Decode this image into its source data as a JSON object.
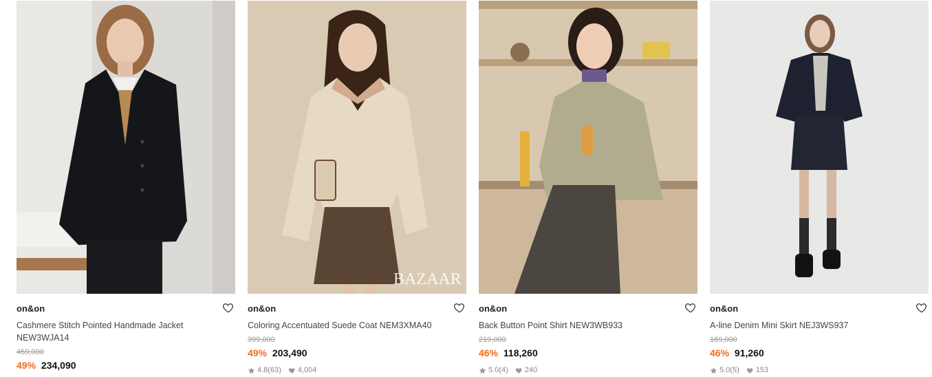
{
  "products": [
    {
      "brand": "on&on",
      "name": "Cashmere Stitch Pointed Handmade Jacket NEW3WJA14",
      "original_price": "459,000",
      "discount": "49%",
      "price": "234,090",
      "rating": "",
      "likes": ""
    },
    {
      "brand": "on&on",
      "name": "Coloring Accentuated Suede Coat NEM3XMA40",
      "original_price": "399,000",
      "discount": "49%",
      "price": "203,490",
      "rating": "4.8(63)",
      "likes": "4,004",
      "image_watermark": "BAZAAR"
    },
    {
      "brand": "on&on",
      "name": "Back Button Point Shirt NEW3WB933",
      "original_price": "219,000",
      "discount": "46%",
      "price": "118,260",
      "rating": "5.0(4)",
      "likes": "240"
    },
    {
      "brand": "on&on",
      "name": "A-line Denim Mini Skirt NEJ3WS937",
      "original_price": "169,000",
      "discount": "46%",
      "price": "91,260",
      "rating": "5.0(5)",
      "likes": "153"
    }
  ],
  "icons": {
    "wishlist": "heart-outline-icon",
    "rating": "star-icon",
    "likes": "heart-filled-icon"
  },
  "colors": {
    "discount": "#f36b1c",
    "price": "#111111",
    "original_price": "#999999"
  }
}
